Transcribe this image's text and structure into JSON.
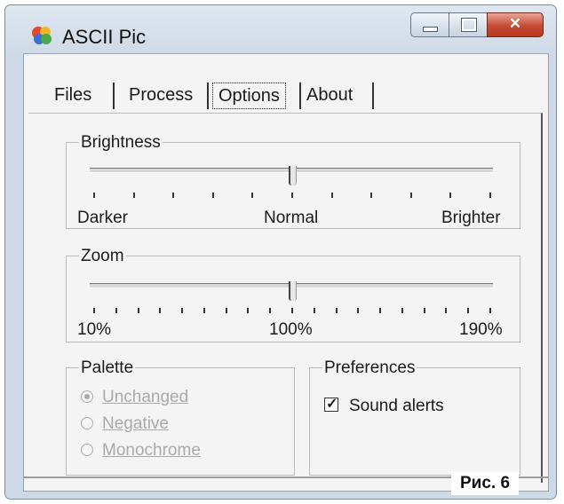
{
  "window": {
    "title": "ASCII Pic"
  },
  "tabs": [
    {
      "label": "Files",
      "active": false
    },
    {
      "label": "Process",
      "active": false
    },
    {
      "label": "Options",
      "active": true
    },
    {
      "label": "About",
      "active": false
    }
  ],
  "brightness": {
    "legend": "Brightness",
    "min_label": "Darker",
    "mid_label": "Normal",
    "max_label": "Brighter",
    "value_fraction": 0.5,
    "tick_count": 11
  },
  "zoom": {
    "legend": "Zoom",
    "min_label": "10%",
    "mid_label": "100%",
    "max_label": "190%",
    "value_fraction": 0.5,
    "tick_count": 19
  },
  "palette": {
    "legend": "Palette",
    "options": [
      {
        "label": "Unchanged",
        "selected": true,
        "enabled": false
      },
      {
        "label": "Negative",
        "selected": false,
        "enabled": false
      },
      {
        "label": "Monochrome",
        "selected": false,
        "enabled": false
      }
    ]
  },
  "preferences": {
    "legend": "Preferences",
    "sound_alerts": {
      "label": "Sound alerts",
      "checked": true
    }
  },
  "figure_caption": "Рис. 6"
}
